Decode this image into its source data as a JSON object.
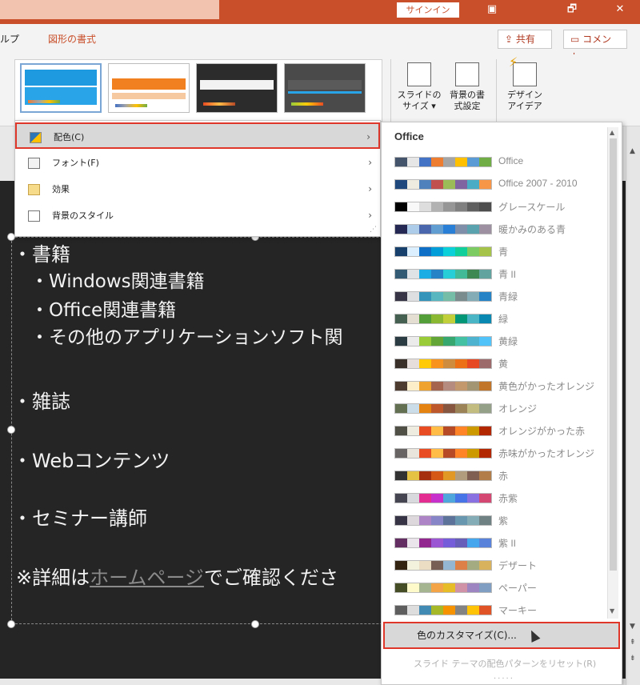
{
  "window": {
    "signin_label": "サインイン",
    "controls": [
      "▣",
      "🗗",
      "✕"
    ]
  },
  "ribbon_tabs": {
    "help_label": "ルプ",
    "shape_format_label": "図形の書式"
  },
  "actions": {
    "share_label": "共有",
    "comment_label": "コメント"
  },
  "ribbon": {
    "slide_size_label": "スライドの\nサイズ ▾",
    "format_bg_label": "背景の書\n式設定",
    "design_ideas_label": "デザイン\nアイデア"
  },
  "variants_menu": {
    "items": [
      {
        "label": "配色(C)",
        "icon": "color-scheme-icon",
        "active": true
      },
      {
        "label": "フォント(F)",
        "icon": "font-icon",
        "active": false
      },
      {
        "label": "効果",
        "icon": "effects-icon",
        "active": false
      },
      {
        "label": "背景のスタイル",
        "icon": "background-style-icon",
        "active": false
      }
    ]
  },
  "slide": {
    "lines": [
      "・書籍",
      "・Windows関連書籍",
      "・Office関連書籍",
      "・その他のアプリケーションソフト関",
      "・雑誌",
      "・Webコンテンツ",
      "・セミナー講師"
    ],
    "note_prefix": "※詳細は",
    "note_link": "ホームページ",
    "note_suffix": "でご確認くださ"
  },
  "color_schemes": {
    "header": "Office",
    "items": [
      {
        "name": "Office",
        "colors": [
          "#44546a",
          "#e7e6e6",
          "#4472c4",
          "#ed7d31",
          "#a5a5a5",
          "#ffc000",
          "#5b9bd5",
          "#70ad47"
        ]
      },
      {
        "name": "Office 2007 - 2010",
        "colors": [
          "#1f497d",
          "#eeece1",
          "#4f81bd",
          "#c0504d",
          "#9bbb59",
          "#8064a2",
          "#4bacc6",
          "#f79646"
        ]
      },
      {
        "name": "グレースケール",
        "colors": [
          "#000000",
          "#f8f8f8",
          "#dddddd",
          "#b2b2b2",
          "#969696",
          "#808080",
          "#5f5f5f",
          "#4d4d4d"
        ]
      },
      {
        "name": "暖かみのある青",
        "colors": [
          "#242852",
          "#acccea",
          "#4a66ac",
          "#629dd1",
          "#297fd5",
          "#7f8fa9",
          "#5aa2ae",
          "#9d90a0"
        ]
      },
      {
        "name": "青",
        "colors": [
          "#17406d",
          "#dbefff",
          "#0f6fc6",
          "#009dd9",
          "#0bd0d9",
          "#10cf9b",
          "#7cca62",
          "#a5c249"
        ]
      },
      {
        "name": "青 II",
        "colors": [
          "#335b74",
          "#dfe3e5",
          "#1cade4",
          "#2683c6",
          "#27ced7",
          "#42ba97",
          "#3e8853",
          "#62a39f"
        ]
      },
      {
        "name": "青緑",
        "colors": [
          "#373545",
          "#dedfe0",
          "#3494ba",
          "#58b6c0",
          "#75bda7",
          "#7a8c8e",
          "#84acb6",
          "#2683c6"
        ]
      },
      {
        "name": "緑",
        "colors": [
          "#455f51",
          "#e3ded1",
          "#549e39",
          "#8ab833",
          "#c0cf3a",
          "#029676",
          "#4ab5c4",
          "#0989b1"
        ]
      },
      {
        "name": "黄緑",
        "colors": [
          "#2c3c43",
          "#ebebeb",
          "#99cb38",
          "#63a537",
          "#37a76f",
          "#44c1a3",
          "#4eb3cf",
          "#51c3f9"
        ]
      },
      {
        "name": "黄",
        "colors": [
          "#39302a",
          "#e5dedb",
          "#ffca08",
          "#f8931d",
          "#ce8d3e",
          "#ec7016",
          "#e64823",
          "#9c6a6a"
        ]
      },
      {
        "name": "黄色がかったオレンジ",
        "colors": [
          "#4e3b30",
          "#fbeec9",
          "#f0a22e",
          "#a5644e",
          "#b58b80",
          "#c3986d",
          "#a19574",
          "#c17529"
        ]
      },
      {
        "name": "オレンジ",
        "colors": [
          "#637052",
          "#ccddea",
          "#e48312",
          "#bd582c",
          "#865640",
          "#9b8357",
          "#c2bc80",
          "#94a088"
        ]
      },
      {
        "name": "オレンジがかった赤",
        "colors": [
          "#505046",
          "#eeece1",
          "#e84c22",
          "#ffbd47",
          "#b64926",
          "#ff8427",
          "#cc9900",
          "#b22600"
        ]
      },
      {
        "name": "赤味がかったオレンジ",
        "colors": [
          "#696464",
          "#e9e5dc",
          "#e84c22",
          "#ffbd47",
          "#b64926",
          "#ff8427",
          "#cc9900",
          "#b22600"
        ]
      },
      {
        "name": "赤",
        "colors": [
          "#323232",
          "#e5c243",
          "#a5300f",
          "#d55816",
          "#e19825",
          "#b19c7d",
          "#7f5f52",
          "#b27d49"
        ]
      },
      {
        "name": "赤紫",
        "colors": [
          "#454551",
          "#d8d9dc",
          "#e32d91",
          "#c830cc",
          "#4ea6dc",
          "#4775e7",
          "#8971e1",
          "#d54773"
        ]
      },
      {
        "name": "紫",
        "colors": [
          "#373545",
          "#dcd8dc",
          "#ad84c6",
          "#8784c7",
          "#5d739a",
          "#6997af",
          "#84acb6",
          "#6f8183"
        ]
      },
      {
        "name": "紫 II",
        "colors": [
          "#632e62",
          "#eae5eb",
          "#92278f",
          "#9b57d3",
          "#755dd9",
          "#665eb8",
          "#45a5ed",
          "#5982db"
        ]
      },
      {
        "name": "デザート",
        "colors": [
          "#332411",
          "#f3f2dc",
          "#ebddc3",
          "#775f55",
          "#94b6d2",
          "#dd8047",
          "#a5ab81",
          "#d8b25c"
        ]
      },
      {
        "name": "ペーパー",
        "colors": [
          "#444d26",
          "#fefac9",
          "#a5b592",
          "#f3a447",
          "#e7bc29",
          "#d092a7",
          "#9c85c0",
          "#809ec2"
        ]
      },
      {
        "name": "マーキー",
        "colors": [
          "#5e5e5e",
          "#ddddde",
          "#418ab3",
          "#a6b727",
          "#f69200",
          "#838383",
          "#fec306",
          "#df5327"
        ]
      }
    ],
    "customize_label": "色のカスタマイズ(C)...",
    "reset_label": "スライド テーマの配色パターンをリセット(R)"
  }
}
